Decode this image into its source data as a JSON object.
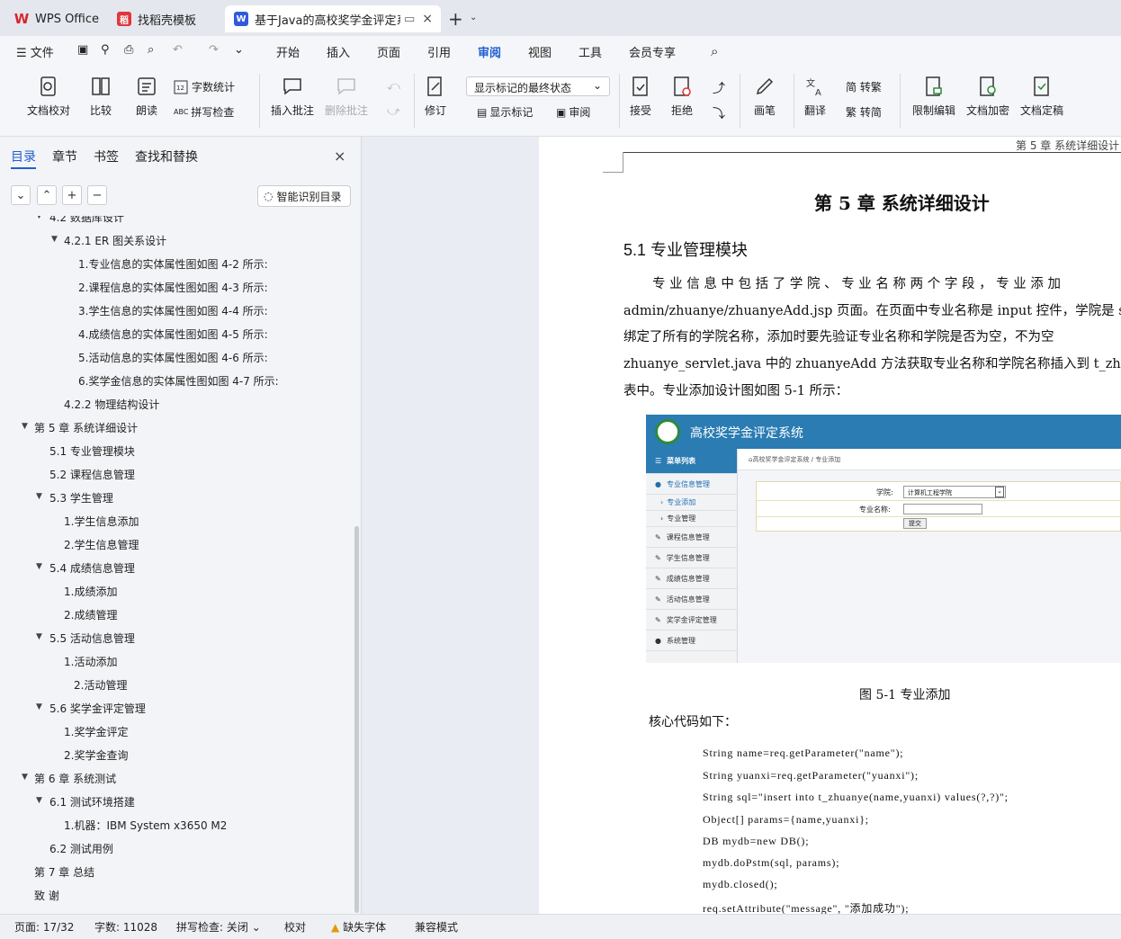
{
  "tabs": [
    {
      "label": "WPS Office",
      "icon": "wps-icon",
      "color": "#d9262d"
    },
    {
      "label": "找稻壳模板",
      "icon": "docer-icon",
      "color": "#e0363b"
    },
    {
      "label": "基于Java的高校奖学金评定系",
      "icon": "writer-icon",
      "color": "#2f5bdb"
    }
  ],
  "menu": {
    "file": "文件",
    "items": [
      "开始",
      "插入",
      "页面",
      "引用",
      "审阅",
      "视图",
      "工具",
      "会员专享"
    ],
    "active": "审阅"
  },
  "ribbon": {
    "proofread": "文档校对",
    "compare": "比较",
    "read_aloud": "朗读",
    "word_count": "字数统计",
    "spell_check": "拼写检查",
    "insert_comment": "插入批注",
    "delete_comment": "删除批注",
    "revise": "修订",
    "markup_select": "显示标记的最终状态",
    "show_markup": "显示标记",
    "review": "审阅",
    "accept": "接受",
    "reject": "拒绝",
    "pen": "画笔",
    "translate": "翻译",
    "simp_to_trad": "简 转繁",
    "trad_to_simp": "繁 转简",
    "restrict_edit": "限制编辑",
    "encrypt": "文档加密",
    "finalize": "文档定稿"
  },
  "sidebar": {
    "tabs": [
      "目录",
      "章节",
      "书签",
      "查找和替换"
    ],
    "smart_toc": "智能识别目录",
    "toc": [
      {
        "t": "4.2 数据库设计",
        "lvl": 2,
        "arrow": true
      },
      {
        "t": "4.2.1 ER 图关系设计",
        "lvl": 3,
        "arrow": true
      },
      {
        "t": "1.专业信息的实体属性图如图 4-2 所示:",
        "lvl": 4
      },
      {
        "t": "2.课程信息的实体属性图如图 4-3 所示:",
        "lvl": 4
      },
      {
        "t": "3.学生信息的实体属性图如图 4-4 所示:",
        "lvl": 4
      },
      {
        "t": "4.成绩信息的实体属性图如图 4-5 所示:",
        "lvl": 4
      },
      {
        "t": "5.活动信息的实体属性图如图 4-6 所示:",
        "lvl": 4
      },
      {
        "t": "6.奖学金信息的实体属性图如图 4-7 所示:",
        "lvl": 4
      },
      {
        "t": "4.2.2 物理结构设计",
        "lvl": 3
      },
      {
        "t": "第 5 章  系统详细设计",
        "lvl": 1,
        "arrow": true
      },
      {
        "t": "5.1  专业管理模块",
        "lvl": 2
      },
      {
        "t": "5.2  课程信息管理",
        "lvl": 2
      },
      {
        "t": "5.3  学生管理",
        "lvl": 2,
        "arrow": true
      },
      {
        "t": "1.学生信息添加",
        "lvl": 3
      },
      {
        "t": "2.学生信息管理",
        "lvl": 3
      },
      {
        "t": "5.4  成绩信息管理",
        "lvl": 2,
        "arrow": true
      },
      {
        "t": "1.成绩添加",
        "lvl": 3
      },
      {
        "t": "2.成绩管理",
        "lvl": 3
      },
      {
        "t": "5.5  活动信息管理",
        "lvl": 2,
        "arrow": true
      },
      {
        "t": "1.活动添加",
        "lvl": 3
      },
      {
        "t": "2.活动管理",
        "lvl": "3b"
      },
      {
        "t": "5.6  奖学金评定管理",
        "lvl": 2,
        "arrow": true
      },
      {
        "t": "1.奖学金评定",
        "lvl": 3
      },
      {
        "t": "2.奖学金查询",
        "lvl": 3
      },
      {
        "t": "第 6 章  系统测试",
        "lvl": 1,
        "arrow": true
      },
      {
        "t": "6.1 测试环境搭建",
        "lvl": 2,
        "arrow": true
      },
      {
        "t": "1.机器：IBM  System  x3650  M2",
        "lvl": 3
      },
      {
        "t": "6.2 测试用例",
        "lvl": 2
      },
      {
        "t": "第 7 章  总结",
        "lvl": 1
      },
      {
        "t": "致  谢",
        "lvl": 1
      }
    ]
  },
  "doc": {
    "header": "第 5 章  系统详细设计",
    "chapter": "第 5 章  系统详细设计",
    "section": "5.1  专业管理模块",
    "para": [
      "专 业 信 息 中 包 括 了 学 院 、 专 业 名 称 两 个 字 段 ， 专 业 添 加",
      "admin/zhuanye/zhuanyeAdd.jsp 页面。在页面中专业名称是 input 控件，学院是 se",
      "绑定了所有的学院名称，添加时要先验证专业名称和学院是否为空，不为空",
      "zhuanye_servlet.java 中的 zhuanyeAdd 方法获取专业名称和学院名称插入到 t_zhu",
      "表中。专业添加设计图如图 5-1 所示："
    ],
    "caption": "图 5-1  专业添加",
    "code_intro": "核心代码如下：",
    "code": [
      "String name=req.getParameter(\"name\");",
      "String yuanxi=req.getParameter(\"yuanxi\");",
      "String sql=\"insert into t_zhuanye(name,yuanxi) values(?,?)\";",
      "Object[] params={name,yuanxi};",
      "DB mydb=new DB();",
      "mydb.doPstm(sql, params);",
      "mydb.closed();",
      "req.setAttribute(\"message\", \"添加成功\");"
    ]
  },
  "screenshot": {
    "title": "高校奖学金评定系统",
    "menu_title": "菜单列表",
    "breadcrumb": "高校奖学金评定系统  /  专业添加",
    "menu": [
      "专业信息管理",
      "专业添加",
      "专业管理",
      "课程信息管理",
      "学生信息管理",
      "成绩信息管理",
      "活动信息管理",
      "奖学金评定管理",
      "系统管理"
    ],
    "college_label": "学院:",
    "college_value": "计算机工程学院",
    "major_label": "专业名称:",
    "submit": "提交"
  },
  "status": {
    "page": "页面: 17/32",
    "words": "字数: 11028",
    "spell": "拼写检查: 关闭",
    "proof": "校对",
    "missing_font": "缺失字体",
    "compat": "兼容模式"
  }
}
